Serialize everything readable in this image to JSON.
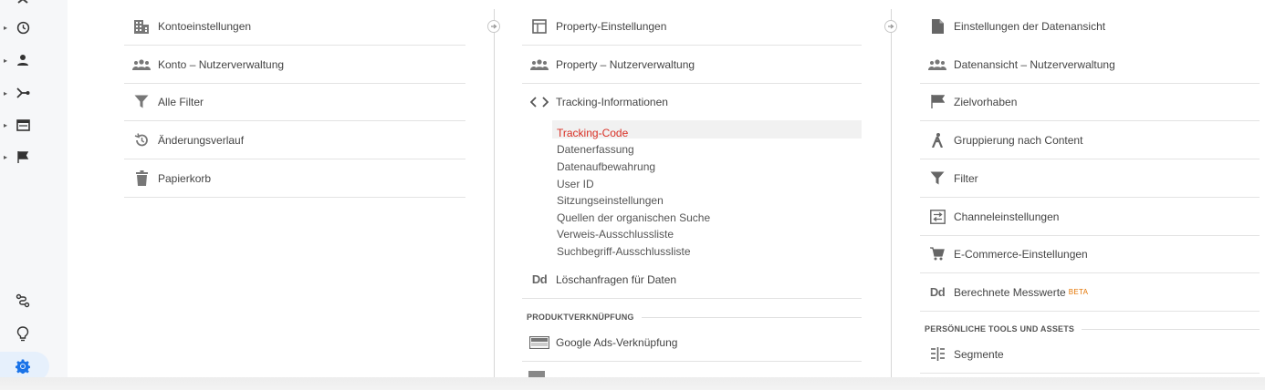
{
  "left_nav": {
    "items": [
      {
        "icon": "clock-icon",
        "caret": "▸"
      },
      {
        "icon": "person-icon",
        "caret": "▸"
      },
      {
        "icon": "merge-icon",
        "caret": "▸"
      },
      {
        "icon": "card-icon",
        "caret": "▸"
      },
      {
        "icon": "flag-icon",
        "caret": "▸"
      }
    ],
    "bottom": [
      {
        "icon": "route-icon"
      },
      {
        "icon": "lightbulb-icon"
      },
      {
        "icon": "gear-icon",
        "active": true
      }
    ]
  },
  "account": {
    "items": [
      {
        "label": "Kontoeinstellungen",
        "icon": "building-icon"
      },
      {
        "label": "Konto – Nutzerverwaltung",
        "icon": "people-icon"
      },
      {
        "label": "Alle Filter",
        "icon": "filter-icon"
      },
      {
        "label": "Änderungsverlauf",
        "icon": "history-icon"
      },
      {
        "label": "Papierkorb",
        "icon": "trash-icon"
      }
    ]
  },
  "property": {
    "items": [
      {
        "label": "Property-Einstellungen",
        "icon": "layout-icon"
      },
      {
        "label": "Property – Nutzerverwaltung",
        "icon": "people-icon"
      },
      {
        "label": "Tracking-Informationen",
        "icon": "code-icon"
      }
    ],
    "tracking_sub": [
      {
        "label": "Tracking-Code",
        "active": true
      },
      {
        "label": "Datenerfassung"
      },
      {
        "label": "Datenaufbewahrung"
      },
      {
        "label": "User ID"
      },
      {
        "label": "Sitzungseinstellungen"
      },
      {
        "label": "Quellen der organischen Suche"
      },
      {
        "label": "Verweis-Ausschlussliste"
      },
      {
        "label": "Suchbegriff-Ausschlussliste"
      }
    ],
    "deletion": {
      "label": "Löschanfragen für Daten",
      "icon_text": "Dd"
    },
    "product_linking_header": "PRODUKTVERKNÜPFUNG",
    "google_ads": {
      "label": "Google Ads-Verknüpfung",
      "icon": "ads-icon"
    }
  },
  "view": {
    "items": [
      {
        "label": "Einstellungen der Datenansicht",
        "icon": "document-icon"
      },
      {
        "label": "Datenansicht – Nutzerverwaltung",
        "icon": "people-icon"
      },
      {
        "label": "Zielvorhaben",
        "icon": "flag-icon"
      },
      {
        "label": "Gruppierung nach Content",
        "icon": "person-walk-icon"
      },
      {
        "label": "Filter",
        "icon": "filter-icon"
      },
      {
        "label": "Channeleinstellungen",
        "icon": "channel-icon"
      },
      {
        "label": "E-Commerce-Einstellungen",
        "icon": "cart-icon"
      }
    ],
    "calculated": {
      "label": "Berechnete Messwerte",
      "badge": "BETA",
      "icon_text": "Dd"
    },
    "personal_header": "PERSÖNLICHE TOOLS UND ASSETS",
    "segments": {
      "label": "Segmente",
      "icon": "segments-icon"
    }
  },
  "colors": {
    "active": "#d93025",
    "beta": "#e37400",
    "gear": "#1a73e8"
  }
}
